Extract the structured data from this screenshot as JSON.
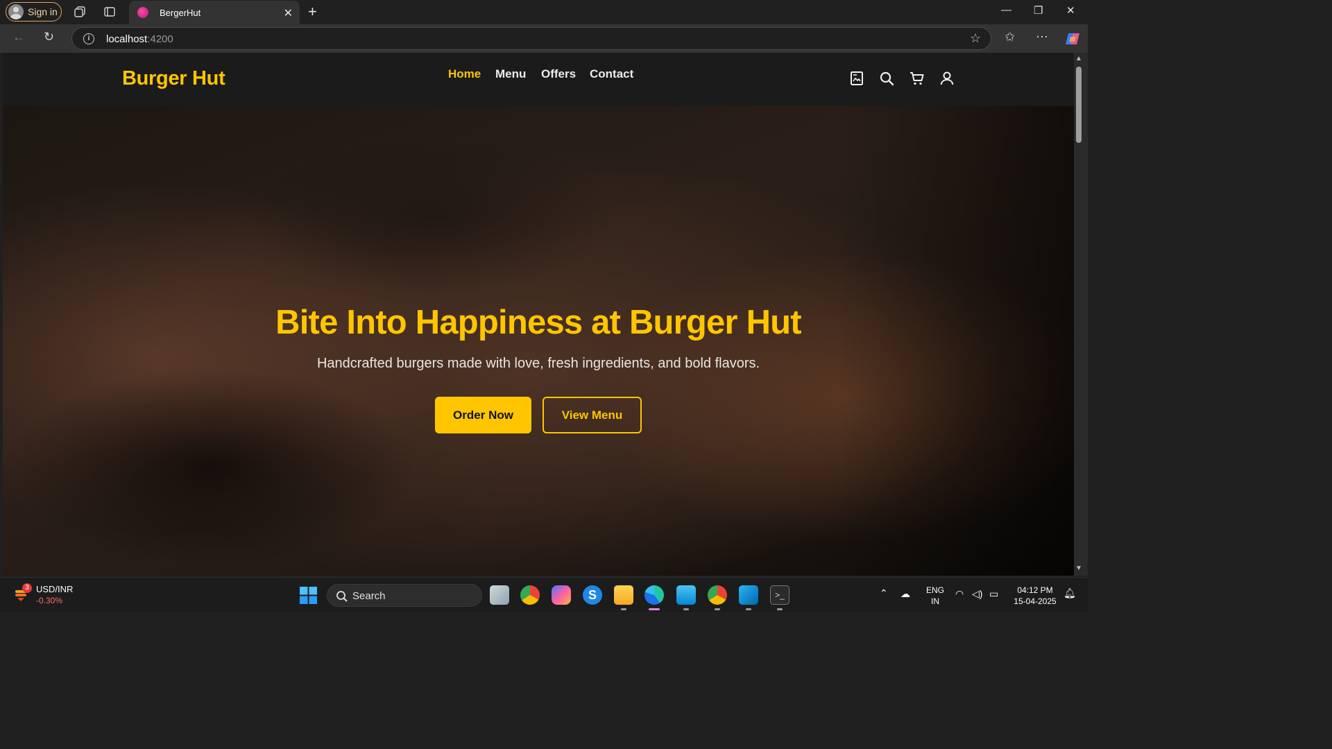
{
  "browser": {
    "signin_label": "Sign in",
    "tab_title": "BergerHut",
    "url_host": "localhost",
    "url_port": ":4200"
  },
  "site": {
    "logo": "Burger Hut",
    "nav": [
      "Home",
      "Menu",
      "Offers",
      "Contact"
    ],
    "active_nav": "Home",
    "nav_icons": [
      "receipt-icon",
      "search-icon",
      "cart-icon",
      "user-icon"
    ],
    "accent_color": "#ffc600"
  },
  "hero": {
    "title": "Bite Into Happiness at Burger Hut",
    "subtitle": "Handcrafted burgers made with love, fresh ingredients, and bold flavors.",
    "primary_button": "Order Now",
    "secondary_button": "View Menu"
  },
  "taskbar": {
    "widget_badge": "3",
    "widget_title": "USD/INR",
    "widget_value": "-0.30%",
    "search_label": "Search",
    "language_line1": "ENG",
    "language_line2": "IN",
    "time": "04:12 PM",
    "date": "15-04-2025"
  }
}
